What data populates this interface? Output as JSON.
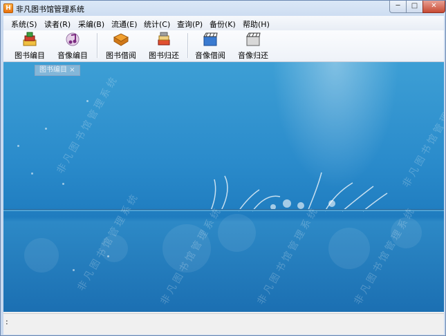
{
  "window": {
    "title": "非凡图书馆管理系统",
    "app_icon_letter": "H",
    "controls": {
      "minimize": "─",
      "maximize": "□",
      "close": "✕"
    }
  },
  "menu": [
    "系统(S)",
    "读者(R)",
    "采编(B)",
    "流通(E)",
    "统计(C)",
    "查询(P)",
    "备份(K)",
    "帮助(H)"
  ],
  "toolbar": [
    {
      "label": "图书编目",
      "icon": "book-catalog-icon"
    },
    {
      "label": "音像编目",
      "icon": "music-catalog-icon"
    },
    {
      "label": "图书借阅",
      "icon": "book-borrow-icon"
    },
    {
      "label": "图书归还",
      "icon": "book-return-icon"
    },
    {
      "label": "音像借阅",
      "icon": "video-borrow-icon"
    },
    {
      "label": "音像归还",
      "icon": "video-return-icon"
    }
  ],
  "mdi_tab": {
    "label": "图书编目",
    "close": "×"
  },
  "watermark_text": "非凡图书馆管理系统",
  "status": {
    "text": ":"
  },
  "colors": {
    "water_top": "#3d9fd5",
    "water_bottom": "#1b6fb2",
    "accent_orange": "#e8700e"
  }
}
